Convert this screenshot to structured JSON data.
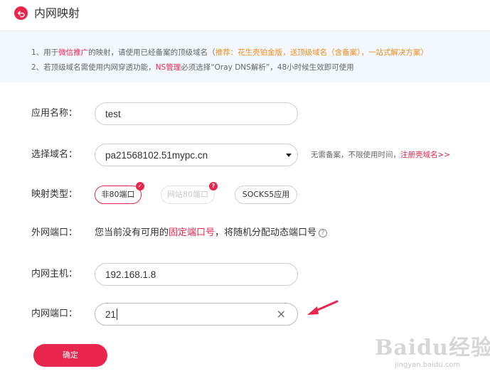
{
  "header": {
    "title": "内网映射"
  },
  "notice": {
    "line1": {
      "prefix": "1、用于",
      "link1": "微信推广",
      "middle": "的映射，请使用已经备案的顶级域名（",
      "rec_label": "推荐：",
      "link2": "花生壳铂金版",
      "sep1": "，",
      "link3": "送顶级域名（含备案）",
      "sep2": "，",
      "link4": "一站式解决方案",
      "suffix": "）"
    },
    "line2": {
      "prefix": "2、若顶级域名需使用内网穿透功能，",
      "link": "NS管理",
      "suffix": "必须选择“Oray DNS解析”，48小时候生效即可使用"
    }
  },
  "form": {
    "app_name": {
      "label": "应用名称：",
      "value": "test"
    },
    "domain": {
      "label": "选择域名：",
      "selected": "pa21568102.51mypc.cn",
      "note": "无需备案，不限使用时间，",
      "note_link": "注册壳域名>>"
    },
    "map_type": {
      "label": "映射类型：",
      "options": [
        {
          "label": "非80端口",
          "state": "selected",
          "badge": "✓"
        },
        {
          "label": "网站80端口",
          "state": "disabled",
          "badge": "?"
        },
        {
          "label": "SOCKS5应用",
          "state": "normal",
          "badge": ""
        }
      ]
    },
    "external_port": {
      "label": "外网端口：",
      "text_prefix": "您当前没有可用的",
      "text_link": "固定端口号",
      "text_suffix": "，将随机分配动态端口号",
      "help_icon": "?"
    },
    "internal_host": {
      "label": "内网主机：",
      "value": "192.168.1.8"
    },
    "internal_port": {
      "label": "内网端口：",
      "value": "21",
      "clear_icon": "×"
    }
  },
  "confirm_button": {
    "label": "确定"
  },
  "watermark": {
    "brand": "Baidu经验",
    "sub": "jingyan.baidu.com"
  },
  "colors": {
    "accent": "#e8264d",
    "orange": "#f08c1e",
    "notice_bg": "#f2f8fd"
  }
}
